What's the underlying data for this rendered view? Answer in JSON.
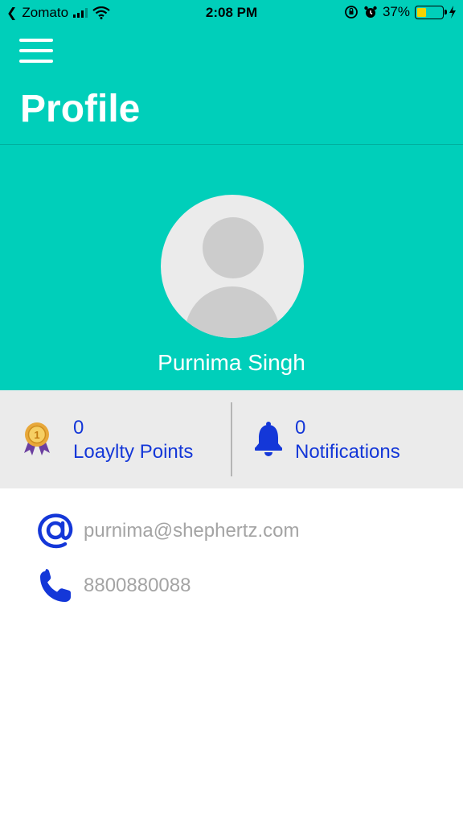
{
  "status_bar": {
    "carrier": "Zomato",
    "time": "2:08 PM",
    "battery_percent": "37%",
    "battery_level": 0.37,
    "icons": [
      "back-arrow-icon",
      "signal-icon",
      "wifi-icon",
      "orientation-lock-icon",
      "alarm-icon",
      "battery-icon",
      "charging-icon"
    ]
  },
  "header": {
    "title": "Profile",
    "menu_icon": "hamburger-menu-icon"
  },
  "profile": {
    "name": "Purnima Singh",
    "avatar_icon": "default-avatar-icon"
  },
  "stats": {
    "loyalty": {
      "count": "0",
      "label": "Loaylty Points",
      "icon": "award-medal-icon"
    },
    "notifications": {
      "count": "0",
      "label": "Notifications",
      "icon": "bell-icon"
    }
  },
  "contact": {
    "email": "purnima@shephertz.com",
    "email_icon": "at-sign-icon",
    "phone": "8800880088",
    "phone_icon": "phone-icon"
  },
  "colors": {
    "header_background": "#00cfba",
    "accent_blue": "#1437d8",
    "stats_background": "#ebebeb",
    "contact_text": "#a4a4a4"
  }
}
